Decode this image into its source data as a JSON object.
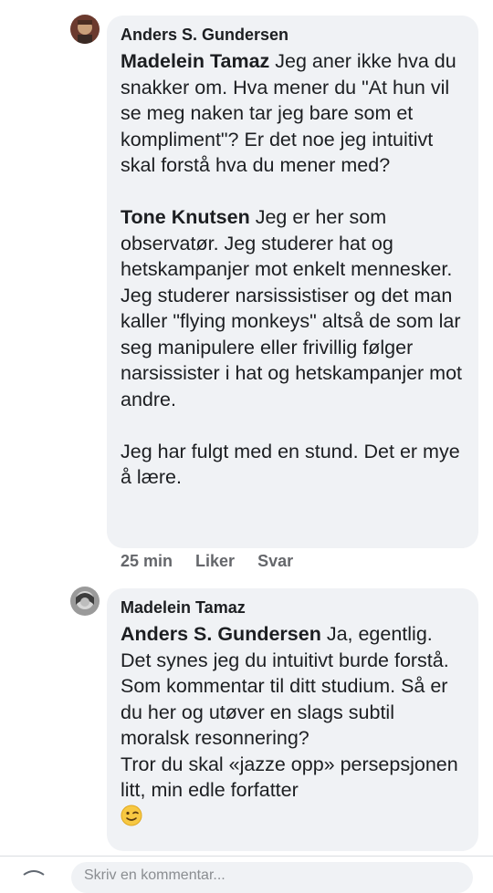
{
  "comments": [
    {
      "author": "Anders S. Gundersen",
      "paragraphs": [
        {
          "mention": "Madelein Tamaz",
          "text": " Jeg aner ikke hva du snakker om. Hva mener du \"At hun vil se meg naken tar jeg bare som et kompliment\"?  Er det noe jeg intuitivt skal forstå hva du mener med?"
        },
        {
          "mention": "Tone Knutsen",
          "text": " Jeg er her som observatør. Jeg studerer hat og hetskampanjer mot enkelt mennesker. Jeg studerer narsissistiser og det man kaller \"flying monkeys\" altså de som lar seg manipulere eller frivillig følger narsissister i hat og hetskampanjer mot andre."
        },
        {
          "mention": "",
          "text": "Jeg har fulgt med en stund. Det er mye å lære."
        }
      ],
      "time": "25 min",
      "like_label": "Liker",
      "reply_label": "Svar"
    },
    {
      "author": "Madelein Tamaz",
      "mention": "Anders S. Gundersen",
      "lines": [
        " Ja, egentlig.",
        "Det synes jeg du intuitivt burde forstå.",
        "Som kommentar til ditt studium. Så er du her og utøver en slags subtil moralsk resonnering?",
        "Tror du skal «jazze opp» persepsjonen litt, min edle forfatter"
      ],
      "emoji": "wink-smiley-icon"
    }
  ],
  "composer": {
    "placeholder": "Skriv en kommentar..."
  }
}
